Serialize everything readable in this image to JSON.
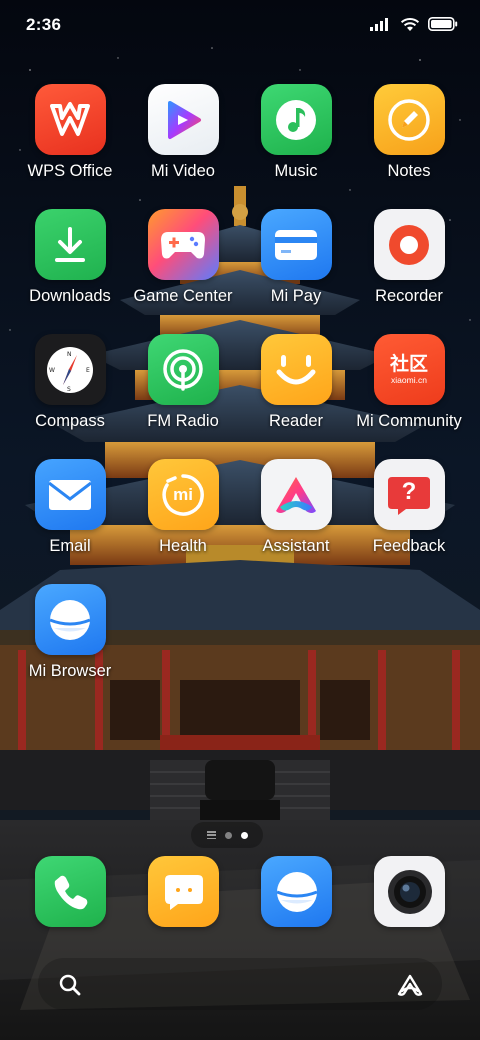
{
  "status_bar": {
    "time": "2:36",
    "icons": [
      "cellular-signal-icon",
      "wifi-icon",
      "battery-icon"
    ]
  },
  "apps": [
    {
      "name": "wps-office",
      "label": "WPS Office",
      "icon": "wps-office-icon"
    },
    {
      "name": "mi-video",
      "label": "Mi Video",
      "icon": "mi-video-icon"
    },
    {
      "name": "music",
      "label": "Music",
      "icon": "music-icon"
    },
    {
      "name": "notes",
      "label": "Notes",
      "icon": "notes-icon"
    },
    {
      "name": "downloads",
      "label": "Downloads",
      "icon": "downloads-icon"
    },
    {
      "name": "game-center",
      "label": "Game Center",
      "icon": "game-center-icon"
    },
    {
      "name": "mi-pay",
      "label": "Mi Pay",
      "icon": "mi-pay-icon"
    },
    {
      "name": "recorder",
      "label": "Recorder",
      "icon": "recorder-icon"
    },
    {
      "name": "compass",
      "label": "Compass",
      "icon": "compass-icon"
    },
    {
      "name": "fm-radio",
      "label": "FM Radio",
      "icon": "fm-radio-icon"
    },
    {
      "name": "reader",
      "label": "Reader",
      "icon": "reader-icon"
    },
    {
      "name": "mi-community",
      "label": "Mi Community",
      "icon": "mi-community-icon",
      "icon_text": "社区",
      "icon_subtext": "xiaomi.cn"
    },
    {
      "name": "email",
      "label": "Email",
      "icon": "email-icon"
    },
    {
      "name": "health",
      "label": "Health",
      "icon": "health-icon",
      "icon_text": "mi"
    },
    {
      "name": "assistant",
      "label": "Assistant",
      "icon": "assistant-icon"
    },
    {
      "name": "feedback",
      "label": "Feedback",
      "icon": "feedback-icon",
      "icon_text": "?"
    },
    {
      "name": "mi-browser",
      "label": "Mi Browser",
      "icon": "mi-browser-icon"
    }
  ],
  "page_indicator": {
    "pages": 2,
    "current": 2
  },
  "dock": [
    {
      "name": "phone",
      "icon": "phone-icon"
    },
    {
      "name": "messaging",
      "icon": "messaging-icon"
    },
    {
      "name": "browser",
      "icon": "browser-icon"
    },
    {
      "name": "camera",
      "icon": "camera-icon"
    }
  ],
  "bottom_bar": {
    "left": "search-icon",
    "right": "assistant-icon"
  },
  "colors": {
    "wps": "#f2462f",
    "music": "#2cc55c",
    "notes": "#f8a91b",
    "downloads": "#2bbf5b",
    "recorder": "#f04a2d",
    "reader": "#ffb51d",
    "mi_community": "#f34a23",
    "email": "#2e8df0",
    "health": "#ffb21e",
    "feedback": "#e83a3a",
    "browser": "#2f8ef0"
  }
}
